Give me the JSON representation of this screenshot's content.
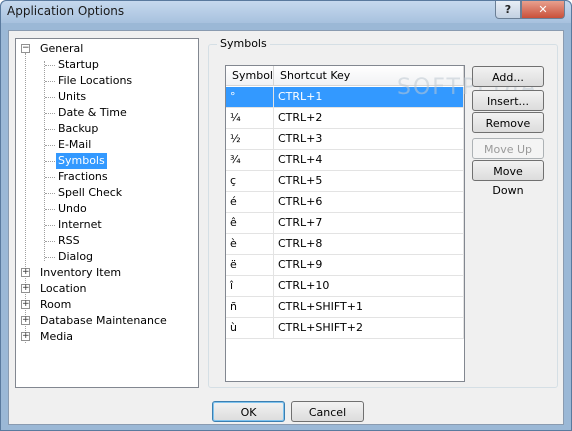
{
  "window": {
    "title": "Application Options",
    "help_glyph": "?",
    "close_glyph": "✕"
  },
  "tree": {
    "general": {
      "label": "General",
      "expander": "−"
    },
    "general_children": [
      "Startup",
      "File Locations",
      "Units",
      "Date & Time",
      "Backup",
      "E-Mail",
      "Symbols",
      "Fractions",
      "Spell Check",
      "Undo",
      "Internet",
      "RSS",
      "Dialog"
    ],
    "selected": "Symbols",
    "collapsed": [
      {
        "label": "Inventory Item",
        "expander": "+"
      },
      {
        "label": "Location",
        "expander": "+"
      },
      {
        "label": "Room",
        "expander": "+"
      },
      {
        "label": "Database Maintenance",
        "expander": "+"
      },
      {
        "label": "Media",
        "expander": "+"
      }
    ]
  },
  "symbols": {
    "group_label": "Symbols",
    "columns": [
      "Symbol",
      "Shortcut Key"
    ],
    "rows": [
      {
        "symbol": "°",
        "key": "CTRL+1"
      },
      {
        "symbol": "¼",
        "key": "CTRL+2"
      },
      {
        "symbol": "½",
        "key": "CTRL+3"
      },
      {
        "symbol": "¾",
        "key": "CTRL+4"
      },
      {
        "symbol": "ç",
        "key": "CTRL+5"
      },
      {
        "symbol": "é",
        "key": "CTRL+6"
      },
      {
        "symbol": "ê",
        "key": "CTRL+7"
      },
      {
        "symbol": "è",
        "key": "CTRL+8"
      },
      {
        "symbol": "ë",
        "key": "CTRL+9"
      },
      {
        "symbol": "î",
        "key": "CTRL+10"
      },
      {
        "symbol": "ñ",
        "key": "CTRL+SHIFT+1"
      },
      {
        "symbol": "ù",
        "key": "CTRL+SHIFT+2"
      }
    ],
    "selected_row": 0
  },
  "actions": {
    "add": "Add...",
    "insert": "Insert...",
    "remove": "Remove",
    "move_up": "Move Up",
    "move_down": "Move Down"
  },
  "dialog": {
    "ok": "OK",
    "cancel": "Cancel"
  },
  "watermark": "SOFTPEDIA",
  "colors": {
    "selection": "#3399ff",
    "title_bar": "#a7c1de",
    "close_button": "#c9503a",
    "client_bg": "#f0f0f0"
  }
}
